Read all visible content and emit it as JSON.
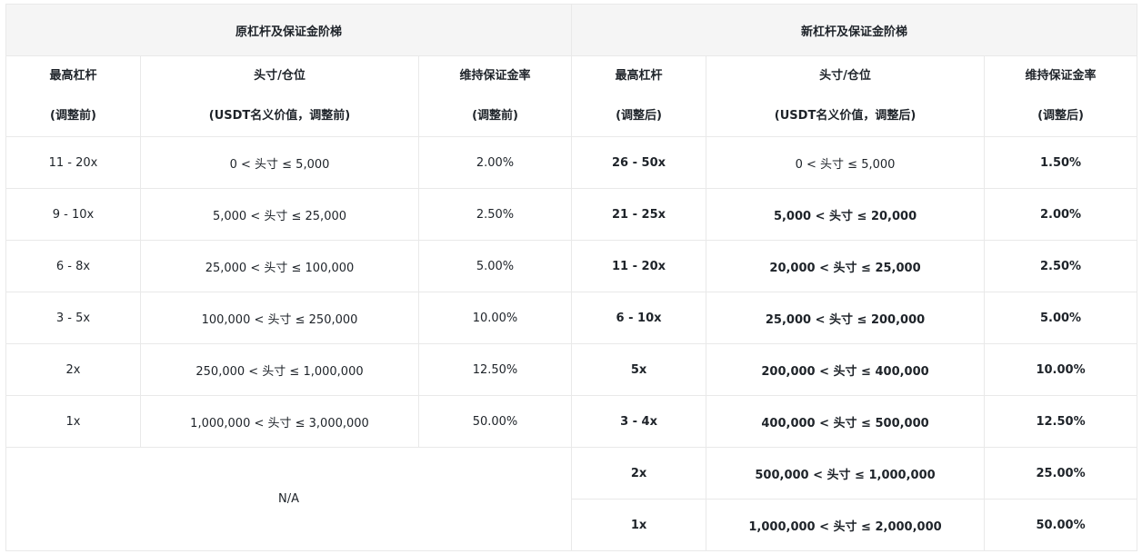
{
  "groups": {
    "old": "原杠杆及保证金阶梯",
    "new": "新杠杆及保证金阶梯"
  },
  "columns": {
    "old_leverage": [
      "最高杠杆",
      "(调整前)"
    ],
    "old_position": [
      "头寸/仓位",
      "(USDT名义价值，调整前)"
    ],
    "old_margin": [
      "维持保证金率",
      "(调整前)"
    ],
    "new_leverage": [
      "最高杠杆",
      "(调整后)"
    ],
    "new_position": [
      "头寸/仓位",
      "(USDT名义价值，调整后)"
    ],
    "new_margin": [
      "维持保证金率",
      "(调整后)"
    ]
  },
  "old_rows": [
    {
      "leverage": "11 - 20x",
      "position": "0 < 头寸 ≤ 5,000",
      "margin": "2.00%"
    },
    {
      "leverage": "9 - 10x",
      "position": "5,000 < 头寸 ≤ 25,000",
      "margin": "2.50%"
    },
    {
      "leverage": "6 - 8x",
      "position": "25,000 < 头寸 ≤ 100,000",
      "margin": "5.00%"
    },
    {
      "leverage": "3 - 5x",
      "position": "100,000 < 头寸 ≤ 250,000",
      "margin": "10.00%"
    },
    {
      "leverage": "2x",
      "position": "250,000 < 头寸 ≤ 1,000,000",
      "margin": "12.50%"
    },
    {
      "leverage": "1x",
      "position": "1,000,000 < 头寸 ≤ 3,000,000",
      "margin": "50.00%"
    }
  ],
  "na_text": "N/A",
  "new_rows": [
    {
      "leverage": "26 - 50x",
      "position": "0 < 头寸 ≤ 5,000",
      "margin": "1.50%"
    },
    {
      "leverage": "21 - 25x",
      "position": "5,000 < 头寸 ≤ 20,000",
      "margin": "2.00%"
    },
    {
      "leverage": "11 - 20x",
      "position": "20,000 < 头寸 ≤ 25,000",
      "margin": "2.50%"
    },
    {
      "leverage": "6 - 10x",
      "position": "25,000 < 头寸 ≤ 200,000",
      "margin": "5.00%"
    },
    {
      "leverage": "5x",
      "position": "200,000 < 头寸 ≤ 400,000",
      "margin": "10.00%"
    },
    {
      "leverage": "3 - 4x",
      "position": "400,000 < 头寸 ≤ 500,000",
      "margin": "12.50%"
    },
    {
      "leverage": "2x",
      "position": "500,000 < 头寸 ≤ 1,000,000",
      "margin": "25.00%"
    },
    {
      "leverage": "1x",
      "position": "1,000,000 < 头寸 ≤ 2,000,000",
      "margin": "50.00%"
    }
  ]
}
